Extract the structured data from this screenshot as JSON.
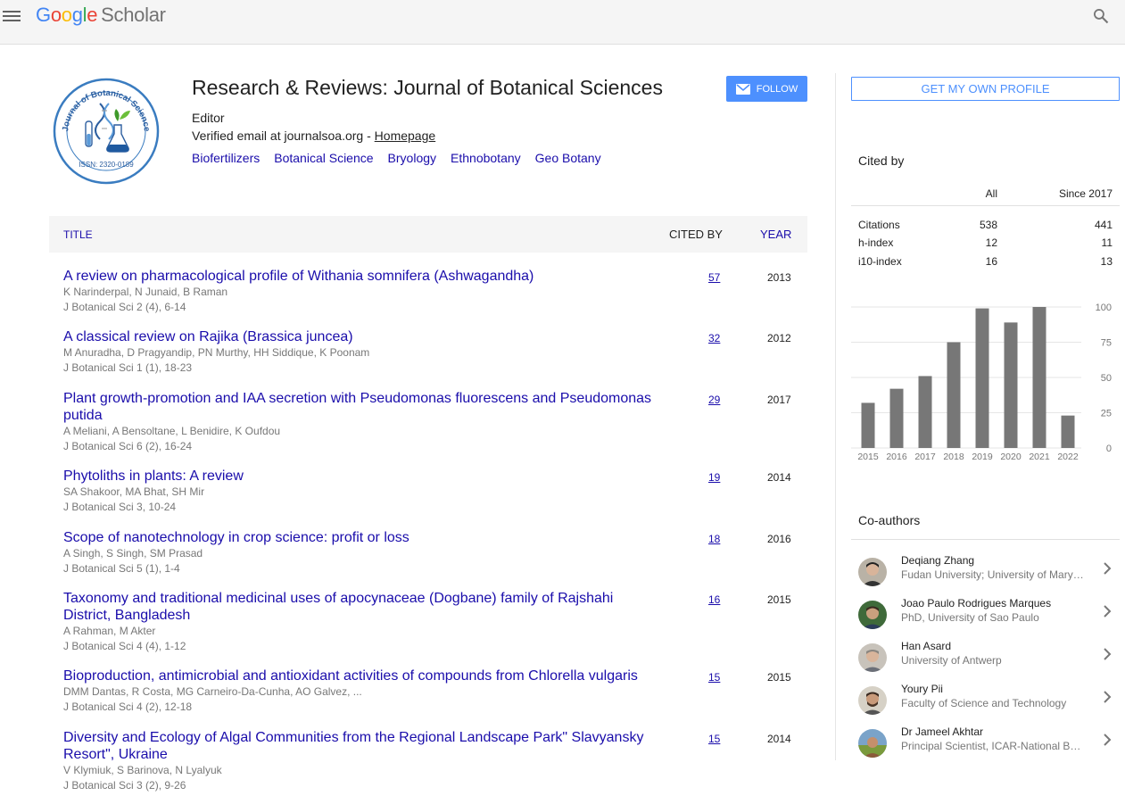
{
  "header": {
    "logo_google": "Google",
    "logo_scholar": "Scholar"
  },
  "profile": {
    "name": "Research & Reviews: Journal of Botanical Sciences",
    "affiliation": "Editor",
    "email_prefix": "Verified email at journalsoa.org - ",
    "homepage_label": "Homepage",
    "follow_label": "FOLLOW",
    "logo_text_top": "Journal of Botanical Science",
    "logo_issn": "ISSN: 2320-0189",
    "interests": [
      "Biofertilizers",
      "Botanical Science",
      "Bryology",
      "Ethnobotany",
      "Geo Botany"
    ]
  },
  "table": {
    "col_title": "TITLE",
    "col_cited": "CITED BY",
    "col_year": "YEAR",
    "rows": [
      {
        "title": "A review on pharmacological profile of Withania somnifera (Ashwagandha)",
        "authors": "K Narinderpal, N Junaid, B Raman",
        "venue": "J Botanical Sci 2 (4), 6-14",
        "cited": "57",
        "year": "2013"
      },
      {
        "title": "A classical review on Rajika (Brassica juncea)",
        "authors": "M Anuradha, D Pragyandip, PN Murthy, HH Siddique, K Poonam",
        "venue": "J Botanical Sci 1 (1), 18-23",
        "cited": "32",
        "year": "2012"
      },
      {
        "title": "Plant growth-promotion and IAA secretion with Pseudomonas fluorescens and Pseudomonas putida",
        "authors": "A Meliani, A Bensoltane, L Benidire, K Oufdou",
        "venue": "J Botanical Sci 6 (2), 16-24",
        "cited": "29",
        "year": "2017"
      },
      {
        "title": "Phytoliths in plants: A review",
        "authors": "SA Shakoor, MA Bhat, SH Mir",
        "venue": "J Botanical Sci 3, 10-24",
        "cited": "19",
        "year": "2014"
      },
      {
        "title": "Scope of nanotechnology in crop science: profit or loss",
        "authors": "A Singh, S Singh, SM Prasad",
        "venue": "J Botanical Sci 5 (1), 1-4",
        "cited": "18",
        "year": "2016"
      },
      {
        "title": "Taxonomy and traditional medicinal uses of apocynaceae (Dogbane) family of Rajshahi District, Bangladesh",
        "authors": "A Rahman, M Akter",
        "venue": "J Botanical Sci 4 (4), 1-12",
        "cited": "16",
        "year": "2015"
      },
      {
        "title": "Bioproduction, antimicrobial and antioxidant activities of compounds from Chlorella vulgaris",
        "authors": "DMM Dantas, R Costa, MG Carneiro-Da-Cunha, AO Galvez, ...",
        "venue": "J Botanical Sci 4 (2), 12-18",
        "cited": "15",
        "year": "2015"
      },
      {
        "title": "Diversity and Ecology of Algal Communities from the Regional Landscape Park\" Slavyansky Resort\", Ukraine",
        "authors": "V Klymiuk, S Barinova, N Lyalyuk",
        "venue": "J Botanical Sci 3 (2), 9-26",
        "cited": "15",
        "year": "2014"
      }
    ]
  },
  "sidebar": {
    "own_profile_label": "GET MY OWN PROFILE",
    "cited_by_title": "Cited by",
    "col_all": "All",
    "col_since": "Since 2017",
    "stats": [
      {
        "label": "Citations",
        "all": "538",
        "since": "441"
      },
      {
        "label": "h-index",
        "all": "12",
        "since": "11"
      },
      {
        "label": "i10-index",
        "all": "16",
        "since": "13"
      }
    ],
    "coauthors_title": "Co-authors",
    "coauthors": [
      {
        "name": "Deqiang Zhang",
        "affiliation": "Fudan University; University of Maryland"
      },
      {
        "name": "Joao Paulo Rodrigues Marques",
        "affiliation": "PhD, University of Sao Paulo"
      },
      {
        "name": "Han Asard",
        "affiliation": "University of Antwerp"
      },
      {
        "name": "Youry Pii",
        "affiliation": "Faculty of Science and Technology"
      },
      {
        "name": "Dr Jameel Akhtar",
        "affiliation": "Principal Scientist, ICAR-National Bureau"
      }
    ]
  },
  "chart_data": {
    "type": "bar",
    "categories": [
      "2015",
      "2016",
      "2017",
      "2018",
      "2019",
      "2020",
      "2021",
      "2022"
    ],
    "values": [
      32,
      42,
      51,
      75,
      99,
      89,
      100,
      23
    ],
    "ylim": [
      0,
      100
    ],
    "yticks": [
      "0",
      "25",
      "50",
      "75",
      "100"
    ],
    "bar_color": "#777777",
    "grid": true
  },
  "colors": {
    "link": "#1a0dab",
    "accent": "#4d90fe",
    "muted": "#777777"
  }
}
